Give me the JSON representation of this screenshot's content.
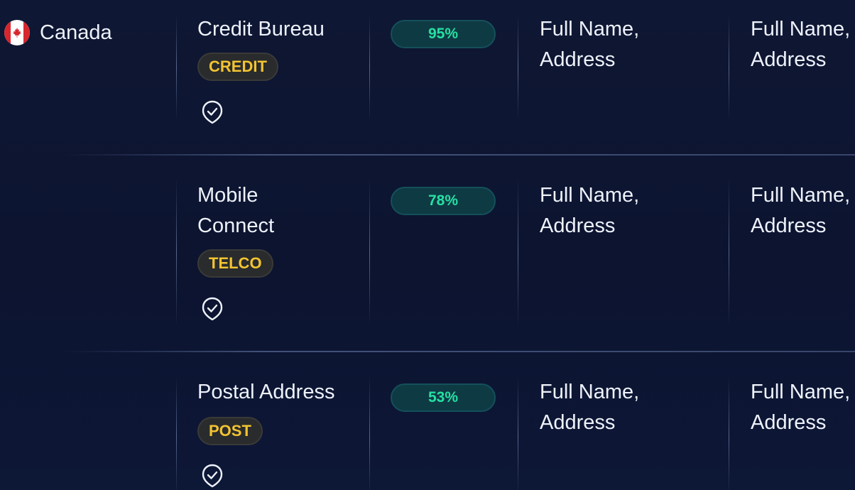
{
  "country": {
    "name": "Canada",
    "flag_icon": "canada-flag-icon"
  },
  "colors": {
    "background": "#0d1530",
    "tag_text": "#f2c431",
    "percent_text": "#26e0a2"
  },
  "rows": [
    {
      "source": "Credit Bureau",
      "tag": "CREDIT",
      "match_percent": "95%",
      "col1": "Full Name,\nAddress",
      "col2": "Full Name,\nAddress",
      "verified_icon": "verified-check-icon"
    },
    {
      "source": "Mobile Connect",
      "tag": "TELCO",
      "match_percent": "78%",
      "col1": "Full Name,\nAddress",
      "col2": "Full Name,\nAddress",
      "verified_icon": "verified-check-icon"
    },
    {
      "source": "Postal Address",
      "tag": "POST",
      "match_percent": "53%",
      "col1": "Full Name,\nAddress",
      "col2": "Full Name,\nAddress",
      "verified_icon": "verified-check-icon"
    }
  ]
}
